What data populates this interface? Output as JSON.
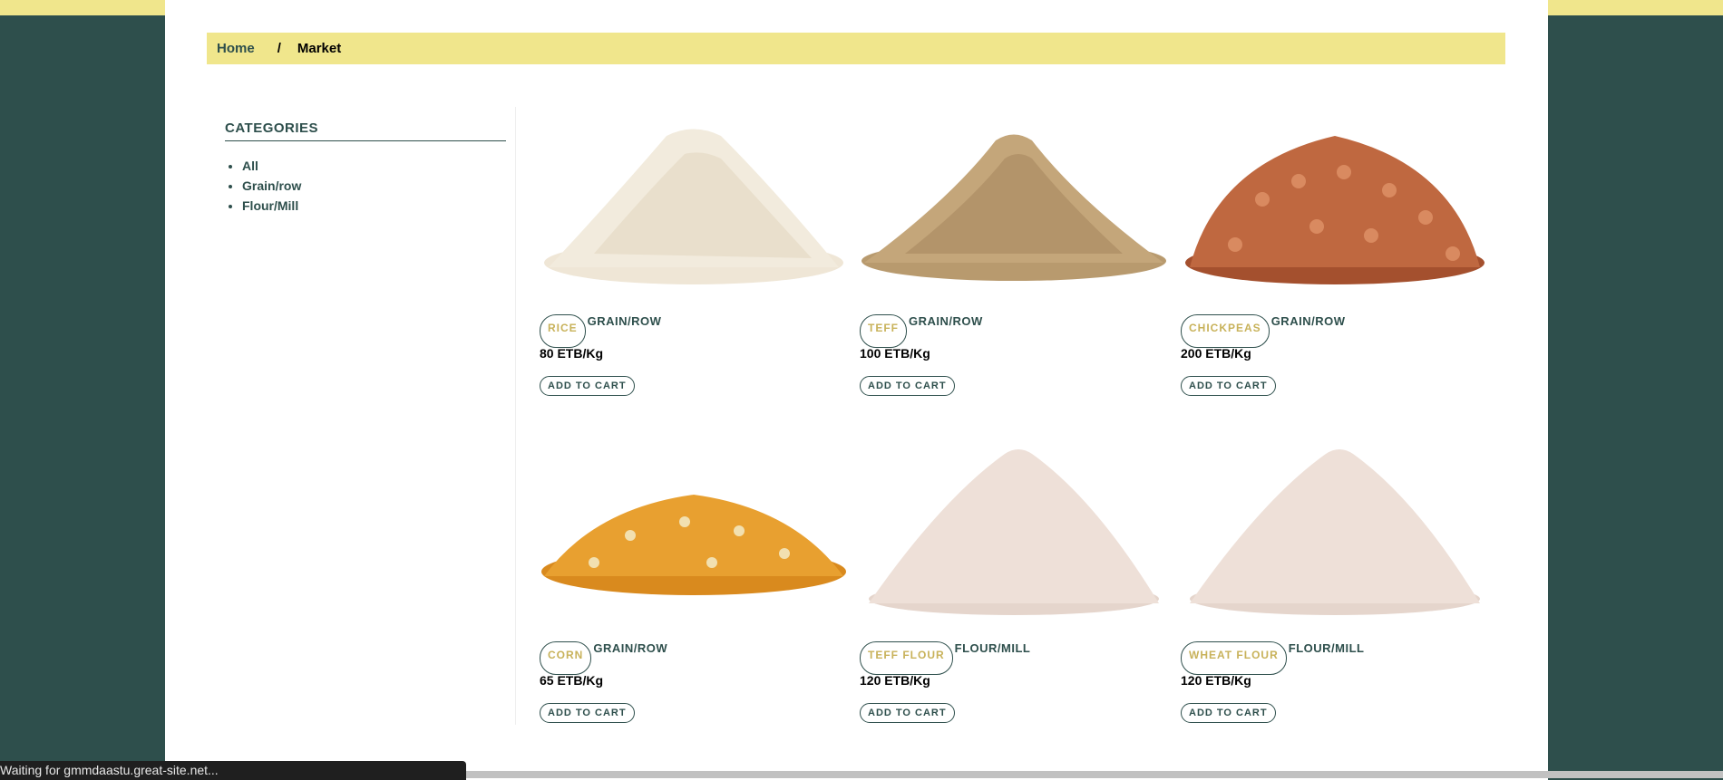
{
  "breadcrumb": {
    "home": "Home",
    "separator": "/",
    "current": "Market"
  },
  "sidebar": {
    "title": "CATEGORIES",
    "items": [
      {
        "label": "All"
      },
      {
        "label": "Grain/row"
      },
      {
        "label": "Flour/Mill"
      }
    ]
  },
  "products": [
    {
      "name": "RICE",
      "category": "GRAIN/ROW",
      "price": "80 ETB/Kg",
      "button": "ADD TO CART",
      "image": "rice-pile-image"
    },
    {
      "name": "TEFF",
      "category": "GRAIN/ROW",
      "price": "100 ETB/Kg",
      "button": "ADD TO CART",
      "image": "teff-pile-image"
    },
    {
      "name": "CHICKPEAS",
      "category": "GRAIN/ROW",
      "price": "200 ETB/Kg",
      "button": "ADD TO CART",
      "image": "chickpeas-pile-image"
    },
    {
      "name": "CORN",
      "category": "GRAIN/ROW",
      "price": "65 ETB/Kg",
      "button": "ADD TO CART",
      "image": "corn-pile-image"
    },
    {
      "name": "TEFF FLOUR",
      "category": "FLOUR/MILL",
      "price": "120 ETB/Kg",
      "button": "ADD TO CART",
      "image": "teff-flour-pile-image"
    },
    {
      "name": "WHEAT FLOUR",
      "category": "FLOUR/MILL",
      "price": "120 ETB/Kg",
      "button": "ADD TO CART",
      "image": "wheat-flour-pile-image"
    }
  ],
  "status": {
    "text": "Waiting for gmmdaastu.great-site.net..."
  },
  "colors": {
    "accent": "#2e4f4c",
    "highlight": "#f0e68c",
    "pill_text": "#c8b25a"
  }
}
